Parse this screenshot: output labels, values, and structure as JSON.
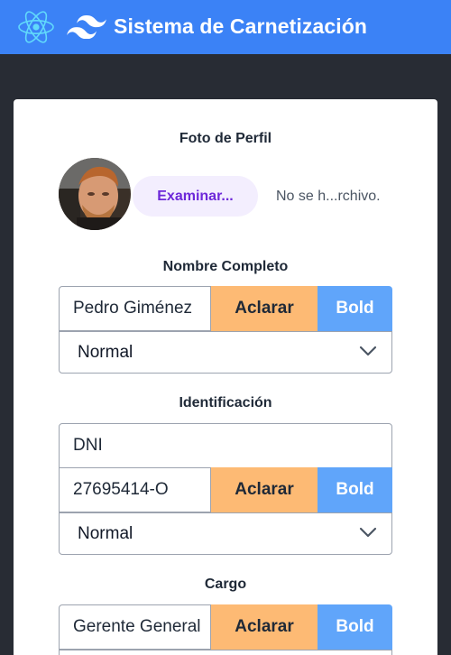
{
  "header": {
    "title": "Sistema de Carnetización",
    "icons": [
      "react-logo-icon",
      "tailwind-logo-icon"
    ],
    "background": "#3b82f6"
  },
  "profile_photo": {
    "label": "Foto de Perfil",
    "browse_label": "Examinar...",
    "file_status": "No se h...rchivo."
  },
  "full_name": {
    "label": "Nombre Completo",
    "value": "Pedro Giménez",
    "clear_label": "Aclarar",
    "bold_label": "Bold",
    "style_selected": "Normal"
  },
  "identification": {
    "label": "Identificación",
    "type_value": "DNI",
    "number_value": "27695414-O",
    "clear_label": "Aclarar",
    "bold_label": "Bold",
    "style_selected": "Normal"
  },
  "position": {
    "label": "Cargo",
    "value": "Gerente General",
    "clear_label": "Aclarar",
    "bold_label": "Bold"
  },
  "colors": {
    "clear_button": "#fdba74",
    "bold_button": "#60a5fa",
    "browse_text": "#6d28d9",
    "page_background": "#282c34"
  }
}
